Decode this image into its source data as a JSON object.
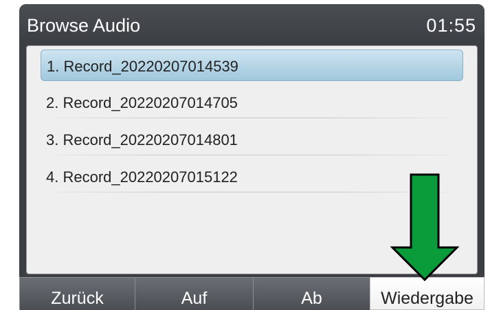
{
  "header": {
    "title": "Browse Audio",
    "clock": "01:55"
  },
  "recordings": [
    {
      "label": "1. Record_20220207014539",
      "selected": true
    },
    {
      "label": "2. Record_20220207014705",
      "selected": false
    },
    {
      "label": "3. Record_20220207014801",
      "selected": false
    },
    {
      "label": "4. Record_20220207015122",
      "selected": false
    }
  ],
  "softkeys": {
    "back": "Zurück",
    "up": "Auf",
    "down": "Ab",
    "play": "Wiedergabe"
  },
  "annotation": {
    "arrow_color": "#0a9b3a",
    "arrow_points_to": "play softkey"
  }
}
